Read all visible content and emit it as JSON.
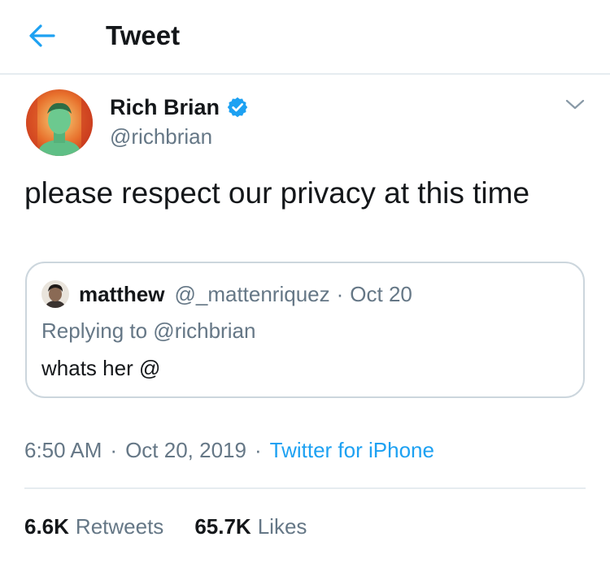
{
  "header": {
    "title": "Tweet",
    "back_icon": "arrow-left-icon"
  },
  "tweet": {
    "author_name": "Rich Brian",
    "author_handle": "@richbrian",
    "verified": true,
    "text": "please respect our privacy at this time",
    "time": "6:50 AM",
    "date": "Oct 20, 2019",
    "separator": "·",
    "source": "Twitter for iPhone"
  },
  "quoted_tweet": {
    "author_name": "matthew",
    "author_handle": "@_mattenriquez",
    "separator": "·",
    "date": "Oct 20",
    "replying_to": "Replying to @richbrian",
    "text": "whats her @"
  },
  "stats": {
    "retweets_count": "6.6K",
    "retweets_label": "Retweets",
    "likes_count": "65.7K",
    "likes_label": "Likes"
  },
  "colors": {
    "accent": "#1da1f2",
    "text_primary": "#14171a",
    "text_secondary": "#657786",
    "border": "#ccd6dd",
    "divider": "#e6ecf0"
  }
}
